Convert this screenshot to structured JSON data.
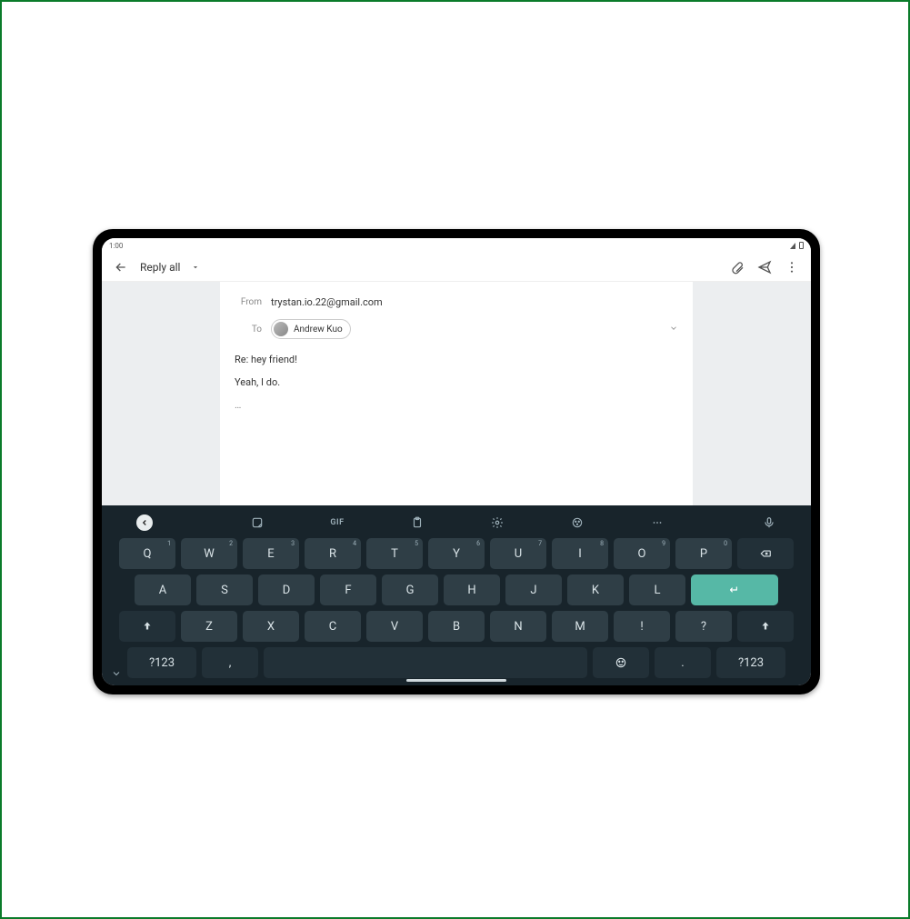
{
  "status": {
    "time": "1:00"
  },
  "toolbar": {
    "title": "Reply all"
  },
  "compose": {
    "from_label": "From",
    "from_value": "trystan.io.22@gmail.com",
    "to_label": "To",
    "to_chip": "Andrew Kuo",
    "subject": "Re: hey friend!",
    "body": "Yeah, I do.",
    "quoted": "…"
  },
  "keyboard": {
    "gif": "GIF",
    "row1": [
      {
        "k": "Q",
        "s": "1"
      },
      {
        "k": "W",
        "s": "2"
      },
      {
        "k": "E",
        "s": "3"
      },
      {
        "k": "R",
        "s": "4"
      },
      {
        "k": "T",
        "s": "5"
      },
      {
        "k": "Y",
        "s": "6"
      },
      {
        "k": "U",
        "s": "7"
      },
      {
        "k": "I",
        "s": "8"
      },
      {
        "k": "O",
        "s": "9"
      },
      {
        "k": "P",
        "s": "0"
      }
    ],
    "row2": [
      "A",
      "S",
      "D",
      "F",
      "G",
      "H",
      "J",
      "K",
      "L"
    ],
    "row3": [
      "Z",
      "X",
      "C",
      "V",
      "B",
      "N",
      "M",
      "!",
      "?"
    ],
    "sym": "?123",
    "comma": ",",
    "period": "."
  }
}
